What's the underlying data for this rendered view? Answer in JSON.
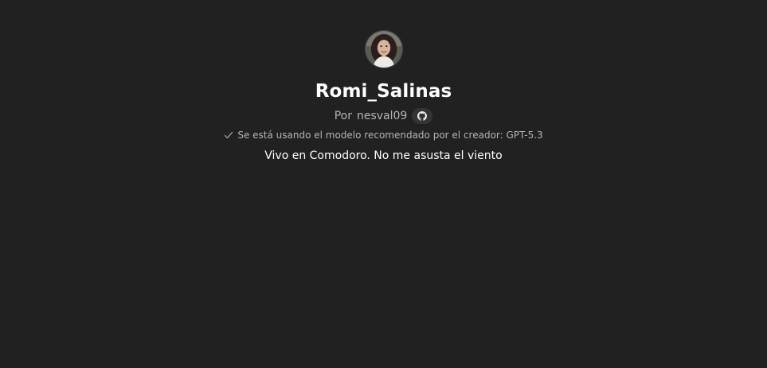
{
  "gpt": {
    "name": "Romi_Salinas",
    "author_prefix": "Por",
    "author": "nesval09",
    "author_link_icon": "github-icon",
    "model_notice_icon": "check-icon",
    "model_notice": "Se está usando el modelo recomendado por el creador: GPT-5.3",
    "description": "Vivo en Comodoro. No me asusta el viento"
  },
  "colors": {
    "background": "#212121",
    "text_primary": "#ffffff",
    "text_secondary": "#b4b4b4",
    "chip_background": "#343434"
  }
}
